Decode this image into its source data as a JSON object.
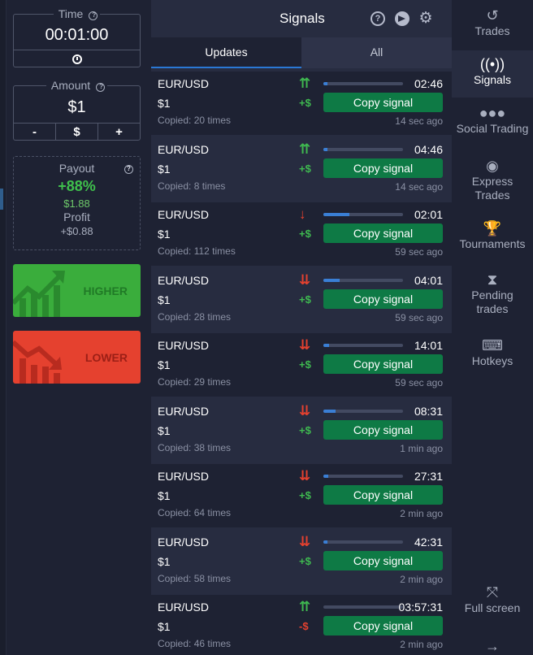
{
  "trade_panel": {
    "time": {
      "label": "Time",
      "value": "00:01:00"
    },
    "amount": {
      "label": "Amount",
      "value": "$1",
      "minus": "-",
      "currency": "$",
      "plus": "+"
    },
    "payout": {
      "label": "Payout",
      "percent": "+88%",
      "amount": "$1.88",
      "profit_label": "Profit",
      "profit_value": "+$0.88"
    },
    "higher_label": "HIGHER",
    "lower_label": "LOWER"
  },
  "signals": {
    "title": "Signals",
    "tabs": [
      {
        "label": "Updates"
      },
      {
        "label": "All"
      }
    ],
    "copy_label": "Copy signal",
    "rows": [
      {
        "pair": "EUR/USD",
        "amount": "$1",
        "copied": "Copied: 20 times",
        "direction": "up",
        "arrow": "⇈",
        "profit": "+$",
        "profit_sign": "pos",
        "time": "02:46",
        "ago": "14 sec ago",
        "progress": 0.05
      },
      {
        "pair": "EUR/USD",
        "amount": "$1",
        "copied": "Copied: 8 times",
        "direction": "up",
        "arrow": "⇈",
        "profit": "+$",
        "profit_sign": "pos",
        "time": "04:46",
        "ago": "14 sec ago",
        "progress": 0.05
      },
      {
        "pair": "EUR/USD",
        "amount": "$1",
        "copied": "Copied: 112 times",
        "direction": "down",
        "arrow": "↓",
        "profit": "+$",
        "profit_sign": "pos",
        "time": "02:01",
        "ago": "59 sec ago",
        "progress": 0.33
      },
      {
        "pair": "EUR/USD",
        "amount": "$1",
        "copied": "Copied: 28 times",
        "direction": "down",
        "arrow": "⇊",
        "profit": "+$",
        "profit_sign": "pos",
        "time": "04:01",
        "ago": "59 sec ago",
        "progress": 0.2
      },
      {
        "pair": "EUR/USD",
        "amount": "$1",
        "copied": "Copied: 29 times",
        "direction": "down",
        "arrow": "⇊",
        "profit": "+$",
        "profit_sign": "pos",
        "time": "14:01",
        "ago": "59 sec ago",
        "progress": 0.07
      },
      {
        "pair": "EUR/USD",
        "amount": "$1",
        "copied": "Copied: 38 times",
        "direction": "down",
        "arrow": "⇊",
        "profit": "+$",
        "profit_sign": "pos",
        "time": "08:31",
        "ago": "1 min ago",
        "progress": 0.15
      },
      {
        "pair": "EUR/USD",
        "amount": "$1",
        "copied": "Copied: 64 times",
        "direction": "down",
        "arrow": "⇊",
        "profit": "+$",
        "profit_sign": "pos",
        "time": "27:31",
        "ago": "2 min ago",
        "progress": 0.06
      },
      {
        "pair": "EUR/USD",
        "amount": "$1",
        "copied": "Copied: 58 times",
        "direction": "down",
        "arrow": "⇊",
        "profit": "+$",
        "profit_sign": "pos",
        "time": "42:31",
        "ago": "2 min ago",
        "progress": 0.05
      },
      {
        "pair": "EUR/USD",
        "amount": "$1",
        "copied": "Copied: 46 times",
        "direction": "up",
        "arrow": "⇈",
        "profit": "-$",
        "profit_sign": "neg",
        "time": "03:57:31",
        "ago": "2 min ago",
        "progress": 0.0
      }
    ]
  },
  "menu": [
    {
      "label": "Trades",
      "icon": "history-icon",
      "glyph": "↺"
    },
    {
      "label": "Signals",
      "icon": "antenna-icon",
      "glyph": "((•))"
    },
    {
      "label": "Social Trading",
      "icon": "users-icon",
      "glyph": "●●●"
    },
    {
      "label": "Express Trades",
      "icon": "target-icon",
      "glyph": "◉"
    },
    {
      "label": "Tournaments",
      "icon": "trophy-icon",
      "glyph": "🏆"
    },
    {
      "label": "Pending trades",
      "icon": "hourglass-icon",
      "glyph": "⧗"
    },
    {
      "label": "Hotkeys",
      "icon": "keyboard-icon",
      "glyph": "⌨"
    },
    {
      "label": "Full screen",
      "icon": "fullscreen-icon",
      "glyph": "⤧"
    },
    {
      "label": "",
      "icon": "arrow-right-icon",
      "glyph": "→"
    }
  ]
}
